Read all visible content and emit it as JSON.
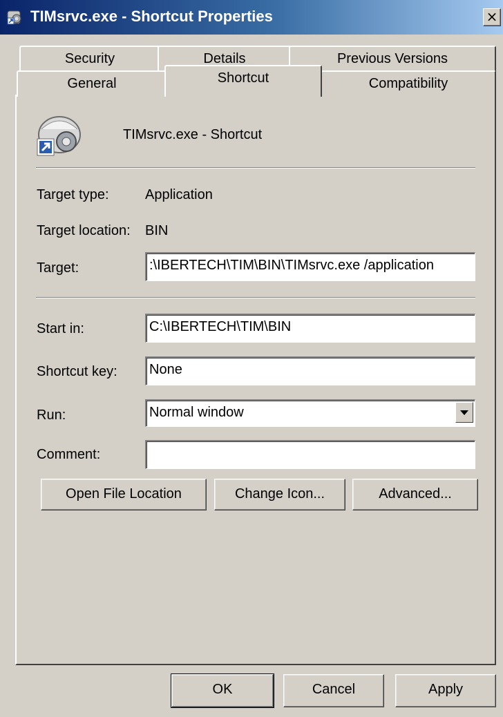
{
  "window": {
    "title": "TIMsrvc.exe - Shortcut Properties",
    "close_label": "×"
  },
  "tabs": [
    {
      "label": "Security"
    },
    {
      "label": "Details"
    },
    {
      "label": "Previous Versions"
    },
    {
      "label": "General"
    },
    {
      "label": "Shortcut"
    },
    {
      "label": "Compatibility"
    }
  ],
  "active_tab": "Shortcut",
  "shortcut": {
    "name": "TIMsrvc.exe - Shortcut",
    "target_type_label": "Target type:",
    "target_type_value": "Application",
    "target_location_label": "Target location:",
    "target_location_value": "BIN",
    "target_label": "Target:",
    "target_value": ":\\IBERTECH\\TIM\\BIN\\TIMsrvc.exe /application",
    "start_in_label": "Start in:",
    "start_in_value": "C:\\IBERTECH\\TIM\\BIN",
    "shortcut_key_label": "Shortcut key:",
    "shortcut_key_value": "None",
    "run_label": "Run:",
    "run_value": "Normal window",
    "comment_label": "Comment:",
    "comment_value": ""
  },
  "buttons": {
    "open_file_location": "Open File Location",
    "change_icon": "Change Icon...",
    "advanced": "Advanced...",
    "ok": "OK",
    "cancel": "Cancel",
    "apply": "Apply"
  },
  "icons": {
    "title": "shortcut-gear-icon",
    "shortcut": "application-gear-shortcut-icon"
  }
}
